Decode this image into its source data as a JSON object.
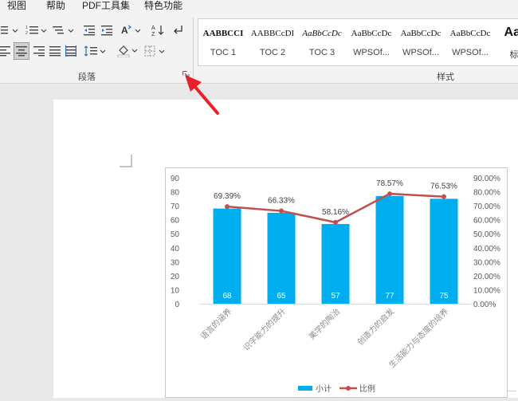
{
  "menu": [
    "视图",
    "帮助",
    "PDF工具集",
    "特色功能"
  ],
  "ribbon": {
    "paragraph_group_label": "段落",
    "styles_group_label": "样式",
    "styles": [
      {
        "sample": "AABBCCI",
        "name": "TOC 1"
      },
      {
        "sample": "AABBCcDI",
        "name": "TOC 2"
      },
      {
        "sample": "AaBbCcDc",
        "name": "TOC 3"
      },
      {
        "sample": "AaBbCcDc",
        "name": "WPSOf..."
      },
      {
        "sample": "AaBbCcDc",
        "name": "WPSOf..."
      },
      {
        "sample": "AaBbCcDc",
        "name": "WPSOf..."
      },
      {
        "sample": "AaI",
        "name": "标"
      }
    ]
  },
  "colors": {
    "bar": "#00aeef",
    "line": "#c0504d",
    "arrow": "#e8202a"
  },
  "chart_data": {
    "type": "bar",
    "categories": [
      "语言的涵养",
      "识字能力的提升",
      "美学的陶冶",
      "创造力的启发",
      "生活能力与态度的培养"
    ],
    "series": [
      {
        "name": "小计",
        "type": "bar",
        "axis": "left",
        "values": [
          68,
          65,
          57,
          77,
          75
        ],
        "value_labels": [
          "68",
          "65",
          "57",
          "77",
          "75"
        ]
      },
      {
        "name": "比例",
        "type": "line",
        "axis": "right",
        "values": [
          69.39,
          66.33,
          58.16,
          78.57,
          76.53
        ],
        "value_labels": [
          "69.39%",
          "66.33%",
          "58.16%",
          "78.57%",
          "76.53%"
        ]
      }
    ],
    "y_left": {
      "min": 0,
      "max": 90,
      "step": 10,
      "ticks": [
        "0",
        "10",
        "20",
        "30",
        "40",
        "50",
        "60",
        "70",
        "80",
        "90"
      ]
    },
    "y_right": {
      "min": 0,
      "max": 90,
      "step": 10,
      "ticks": [
        "0.00%",
        "10.00%",
        "20.00%",
        "30.00%",
        "40.00%",
        "50.00%",
        "60.00%",
        "70.00%",
        "80.00%",
        "90.00%"
      ]
    },
    "grid": false,
    "legend": "bottom"
  }
}
